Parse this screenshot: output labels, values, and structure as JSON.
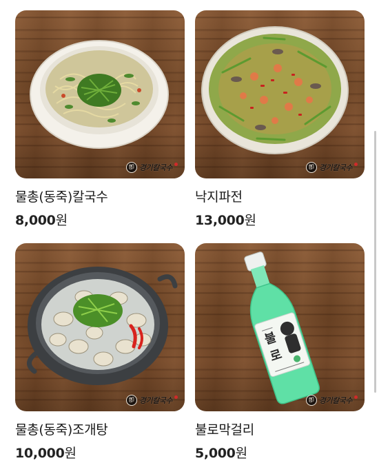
{
  "brand": {
    "logo_text": "경기칼국수",
    "logo_mark_glyph": "卽"
  },
  "items": [
    {
      "name": "물총(동죽)칼국수",
      "price": "8,000",
      "currency": "원",
      "image_icon": "noodle-soup-bowl"
    },
    {
      "name": "낙지파전",
      "price": "13,000",
      "currency": "원",
      "image_icon": "seafood-pancake"
    },
    {
      "name": "물총(동죽)조개탕",
      "price": "10,000",
      "currency": "원",
      "image_icon": "clam-soup-pot"
    },
    {
      "name": "불로막걸리",
      "price": "5,000",
      "currency": "원",
      "image_icon": "makgeolli-bottle"
    }
  ],
  "colors": {
    "wood": "#6f4525",
    "text": "#1a1a1a",
    "brand_dot": "#d12a2a"
  }
}
